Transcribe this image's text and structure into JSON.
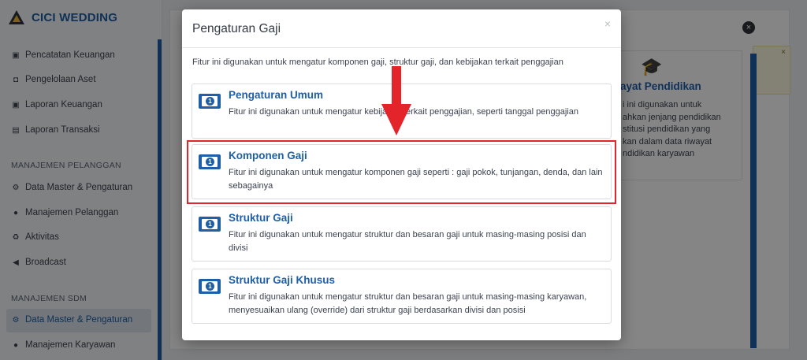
{
  "brand": {
    "name": "CICI WEDDING"
  },
  "sidebar": {
    "items_top": [
      {
        "label": "Pencatatan Keuangan",
        "icon": "money-icon"
      },
      {
        "label": "Pengelolaan Aset",
        "icon": "car-icon"
      },
      {
        "label": "Laporan Keuangan",
        "icon": "money-icon"
      },
      {
        "label": "Laporan Transaksi",
        "icon": "book-icon"
      }
    ],
    "section_pelanggan": {
      "heading": "MANAJEMEN PELANGGAN",
      "items": [
        {
          "label": "Data Master & Pengaturan",
          "icon": "cogs-icon"
        },
        {
          "label": "Manajemen Pelanggan",
          "icon": "users-icon"
        },
        {
          "label": "Aktivitas",
          "icon": "recycle-icon"
        },
        {
          "label": "Broadcast",
          "icon": "bullhorn-icon"
        }
      ]
    },
    "section_sdm": {
      "heading": "MANAJEMEN SDM",
      "items": [
        {
          "label": "Data Master & Pengaturan",
          "icon": "cogs-icon",
          "active": true
        },
        {
          "label": "Manajemen Karyawan",
          "icon": "users-icon"
        }
      ]
    }
  },
  "background": {
    "panel_title": "ayat Pendidikan",
    "panel_desc": "i ini digunakan untuk\nahkan jenjang pendidikan\nstitusi pendidikan yang\nkan dalam data riwayat\nndidikan karyawan",
    "close_symbol": "×",
    "alert_close": "×"
  },
  "modal": {
    "title": "Pengaturan Gaji",
    "close": "×",
    "intro": "Fitur ini digunakan untuk mengatur komponen gaji, struktur gaji, dan kebijakan terkait penggajian",
    "options": [
      {
        "title": "Pengaturan Umum",
        "desc": "Fitur ini digunakan untuk mengatur kebijakan terkait penggajian, seperti tanggal penggajian"
      },
      {
        "title": "Komponen Gaji",
        "desc": "Fitur ini digunakan untuk mengatur komponen gaji seperti : gaji pokok, tunjangan, denda, dan lain sebagainya"
      },
      {
        "title": "Struktur Gaji",
        "desc": "Fitur ini digunakan untuk mengatur struktur dan besaran gaji untuk masing-masing posisi dan divisi"
      },
      {
        "title": "Struktur Gaji Khusus",
        "desc": "Fitur ini digunakan untuk mengatur struktur dan besaran gaji untuk masing-masing karyawan, menyesuaikan ulang (override) dari struktur gaji berdasarkan divisi dan posisi"
      }
    ]
  },
  "colors": {
    "accent": "#1f5fa8",
    "highlight": "#e3242b"
  }
}
